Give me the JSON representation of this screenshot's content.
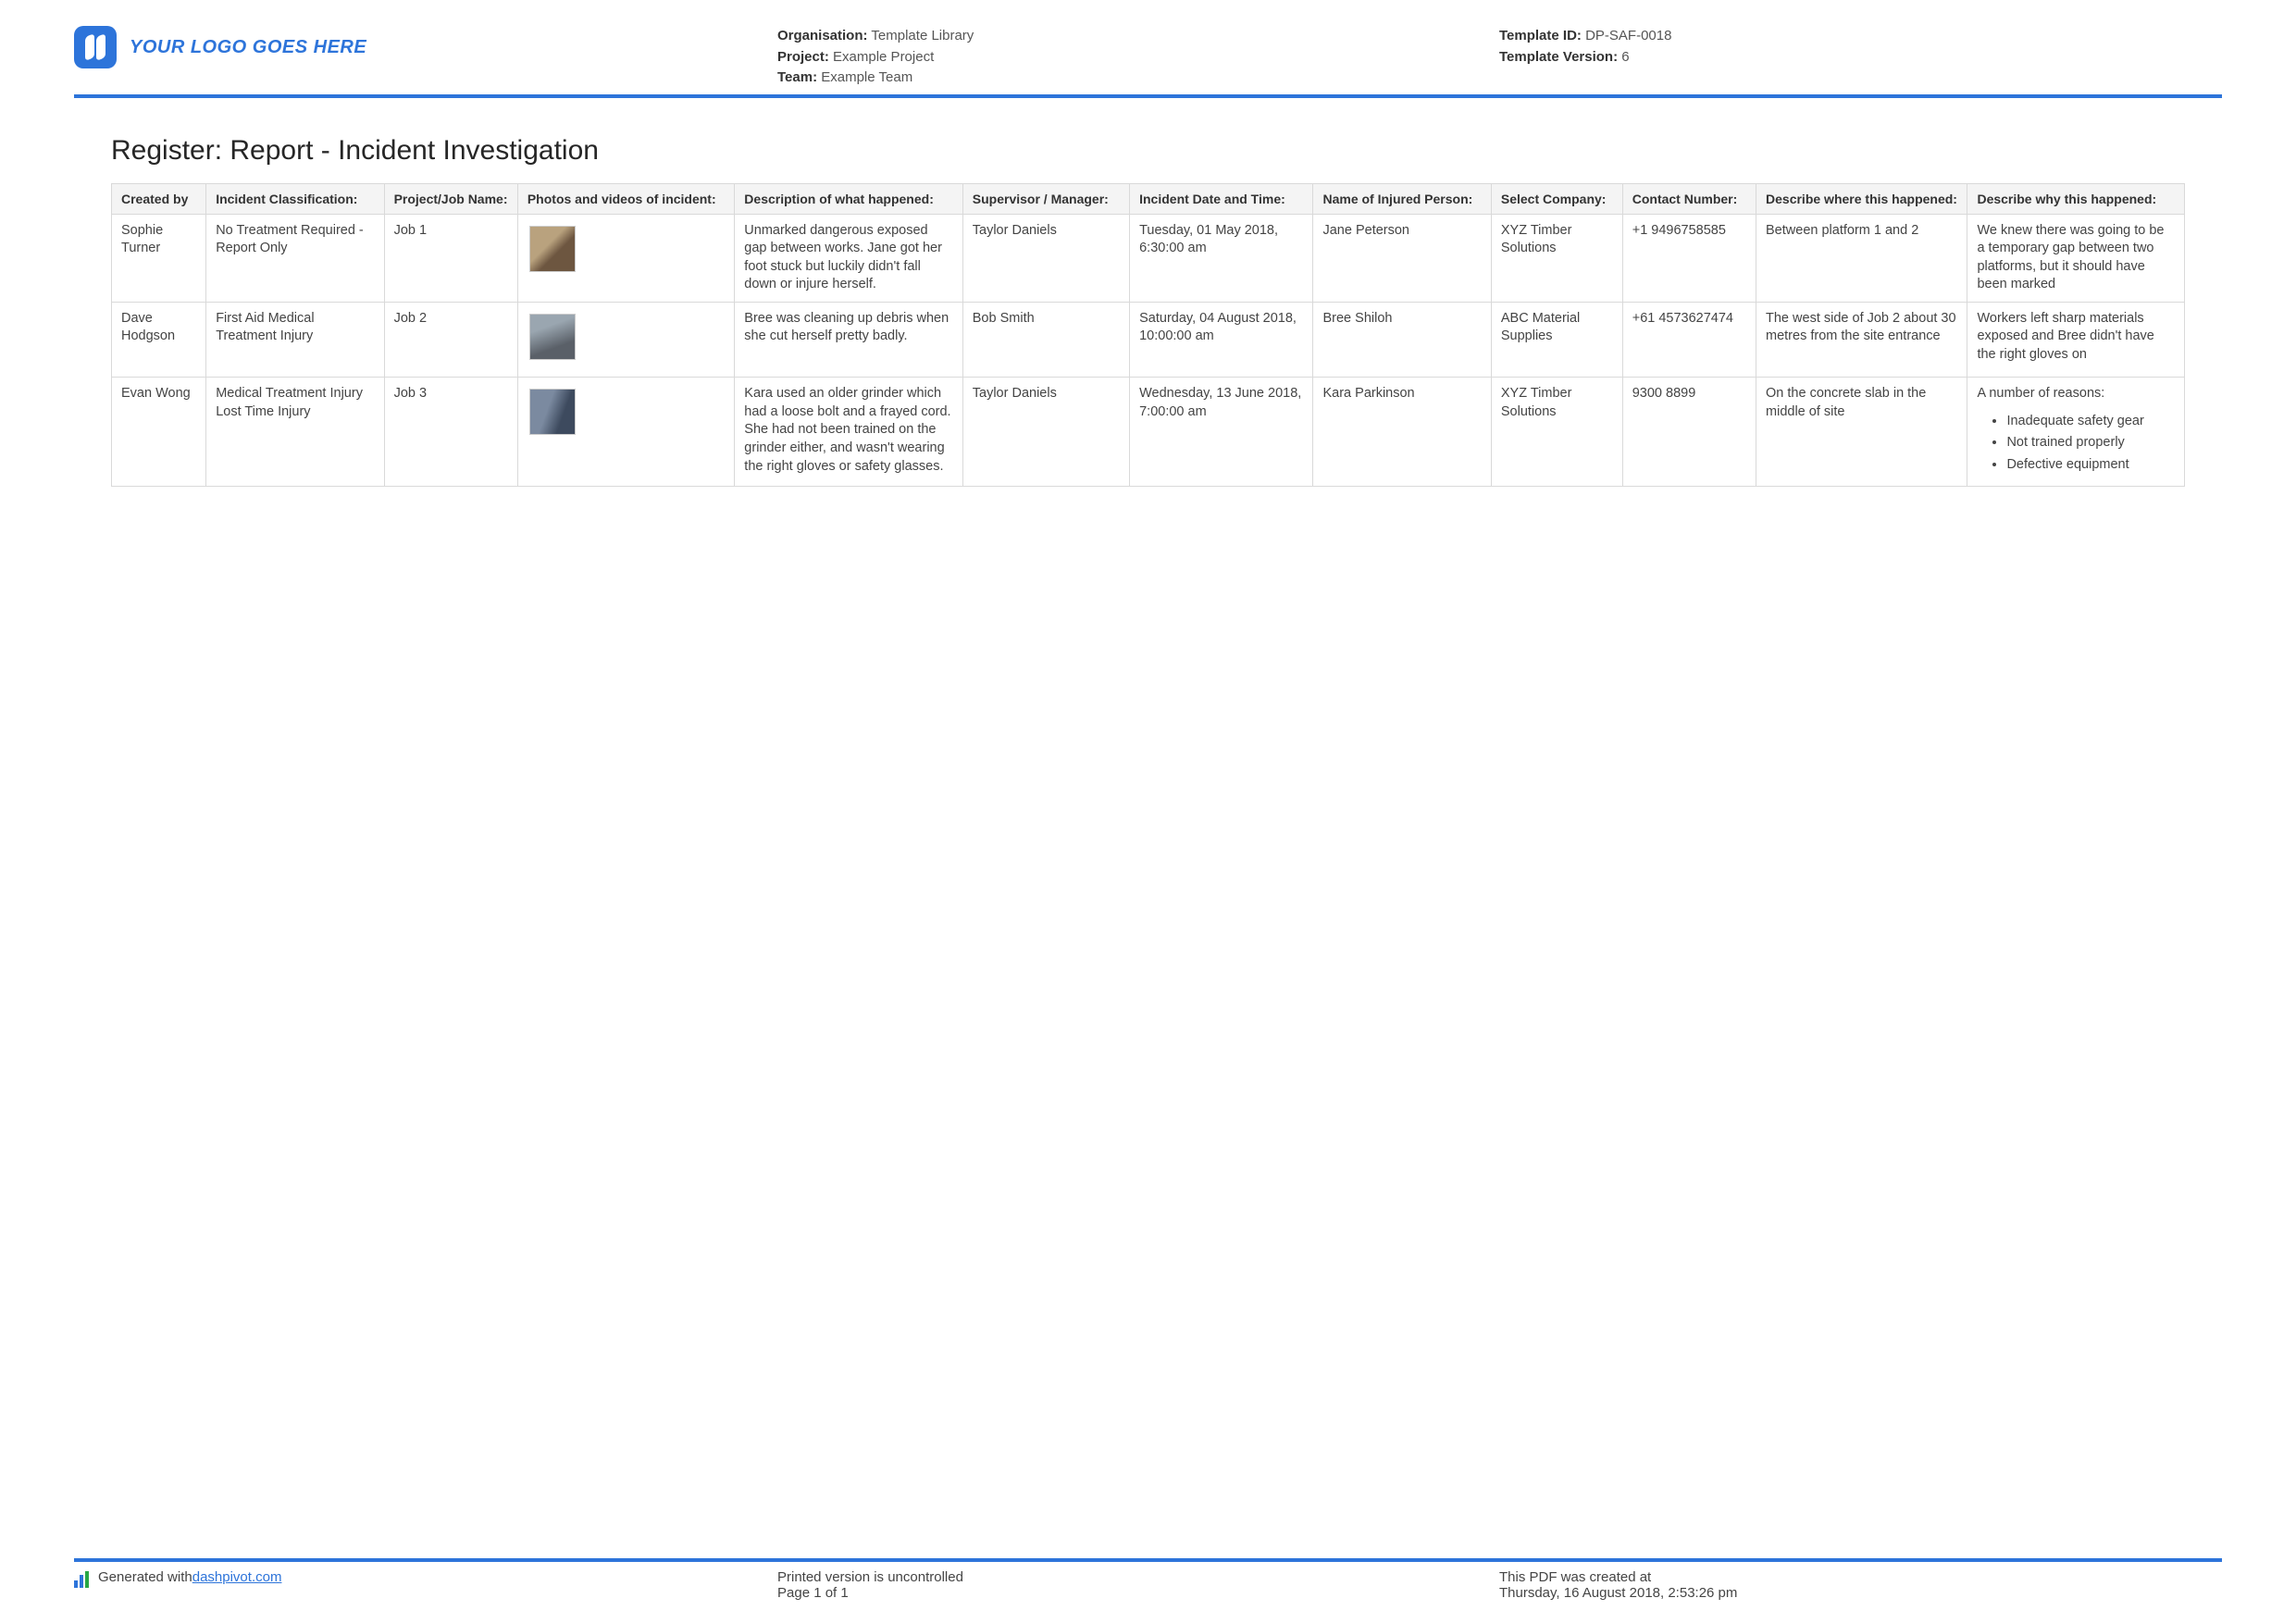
{
  "header": {
    "logo_text": "YOUR LOGO GOES HERE",
    "organisation_label": "Organisation:",
    "organisation_value": "Template Library",
    "project_label": "Project:",
    "project_value": "Example Project",
    "team_label": "Team:",
    "team_value": "Example Team",
    "template_id_label": "Template ID:",
    "template_id_value": "DP-SAF-0018",
    "template_version_label": "Template Version:",
    "template_version_value": "6"
  },
  "page_title": "Register: Report - Incident Investigation",
  "columns": {
    "created_by": "Created by",
    "classification": "Incident Classification:",
    "job": "Project/Job Name:",
    "photos": "Photos and videos of incident:",
    "description": "Description of what happened:",
    "supervisor": "Supervisor / Manager:",
    "datetime": "Incident Date and Time:",
    "injured": "Name of Injured Person:",
    "company": "Select Company:",
    "contact": "Contact Number:",
    "where": "Describe where this happened:",
    "why": "Describe why this happened:"
  },
  "rows": [
    {
      "created_by": "Sophie Turner",
      "classification": "No Treatment Required - Report Only",
      "job": "Job 1",
      "description": "Unmarked dangerous exposed gap between works. Jane got her foot stuck but luckily didn't fall down or injure herself.",
      "supervisor": "Taylor Daniels",
      "datetime": "Tuesday, 01 May 2018, 6:30:00 am",
      "injured": "Jane Peterson",
      "company": "XYZ Timber Solutions",
      "contact": "+1 9496758585",
      "where": "Between platform 1 and 2",
      "why_text": "We knew there was going to be a temporary gap between two platforms, but it should have been marked",
      "why_list": []
    },
    {
      "created_by": "Dave Hodgson",
      "classification": "First Aid    Medical Treatment Injury",
      "job": "Job 2",
      "description": "Bree was cleaning up debris when she cut herself pretty badly.",
      "supervisor": "Bob Smith",
      "datetime": "Saturday, 04 August 2018, 10:00:00 am",
      "injured": "Bree Shiloh",
      "company": "ABC Material Supplies",
      "contact": "+61 4573627474",
      "where": "The west side of Job 2 about 30 metres from the site entrance",
      "why_text": "Workers left sharp materials exposed and Bree didn't have the right gloves on",
      "why_list": []
    },
    {
      "created_by": "Evan Wong",
      "classification": "Medical Treatment Injury    Lost Time Injury",
      "job": "Job 3",
      "description": "Kara used an older grinder which had a loose bolt and a frayed cord. She had not been trained on the grinder either, and wasn't wearing the right gloves or safety glasses.",
      "supervisor": "Taylor Daniels",
      "datetime": "Wednesday, 13 June 2018, 7:00:00 am",
      "injured": "Kara Parkinson",
      "company": "XYZ Timber Solutions",
      "contact": "9300 8899",
      "where": "On the concrete slab in the middle of site",
      "why_text": "A number of reasons:",
      "why_list": [
        "Inadequate safety gear",
        "Not trained properly",
        "Defective equipment"
      ]
    }
  ],
  "footer": {
    "generated_prefix": "Generated with ",
    "generated_link_text": "dashpivot.com",
    "uncontrolled": "Printed version is uncontrolled",
    "page_info": "Page 1 of 1",
    "created_label": "This PDF was created at",
    "created_value": "Thursday, 16 August 2018, 2:53:26 pm"
  }
}
